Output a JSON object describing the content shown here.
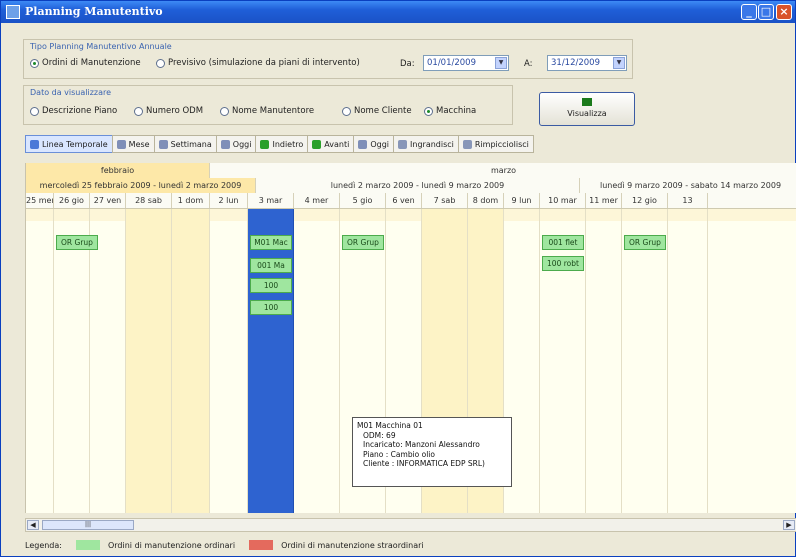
{
  "window": {
    "title": "Planning Manutentivo"
  },
  "mode_panel": {
    "title": "Tipo Planning Manutentivo Annuale",
    "options": [
      {
        "label": "Ordini di Manutenzione",
        "selected": true
      },
      {
        "label": "Previsivo (simulazione da piani di intervento)",
        "selected": false
      }
    ],
    "from_label": "Da:",
    "from_value": "01/01/2009",
    "to_label": "A:",
    "to_value": "31/12/2009"
  },
  "view_panel": {
    "title": "Dato da visualizzare",
    "options": [
      {
        "label": "Descrizione Piano",
        "selected": false
      },
      {
        "label": "Numero ODM",
        "selected": false
      },
      {
        "label": "Nome Manutentore",
        "selected": false
      },
      {
        "label": "Nome Cliente",
        "selected": false
      },
      {
        "label": "Macchina",
        "selected": true
      }
    ]
  },
  "visualize_button": {
    "label": "Visualizza",
    "icon": "monitor-icon"
  },
  "toolbar": [
    {
      "label": "Linea Temporale",
      "icon": "timeline-icon",
      "active": true
    },
    {
      "label": "Mese",
      "icon": "calendar-month-icon",
      "active": false
    },
    {
      "label": "Settimana",
      "icon": "calendar-week-icon",
      "active": false
    },
    {
      "label": "Oggi",
      "icon": "calendar-today-icon",
      "active": false
    },
    {
      "label": "Indietro",
      "icon": "back-arrow-icon",
      "active": false
    },
    {
      "label": "Avanti",
      "icon": "forward-arrow-icon",
      "active": false
    },
    {
      "label": "Oggi",
      "icon": "today-icon",
      "active": false
    },
    {
      "label": "Ingrandisci",
      "icon": "zoom-in-icon",
      "active": false
    },
    {
      "label": "Rimpicciolisci",
      "icon": "zoom-out-icon",
      "active": false
    }
  ],
  "calendar": {
    "months": [
      "febbraio",
      "marzo"
    ],
    "weeks": [
      "mercoledì 25 febbraio 2009 - lunedì 2 marzo 2009",
      "lunedì 2 marzo 2009 - lunedì 9 marzo 2009",
      "lunedì 9 marzo 2009 - sabato 14 marzo 2009"
    ],
    "days": [
      "25 mer",
      "26 gio",
      "27 ven",
      "28 sab",
      "1 dom",
      "2 lun",
      "3 mar",
      "4 mer",
      "5 gio",
      "6 ven",
      "7 sab",
      "8 dom",
      "9 lun",
      "10 mar",
      "11 mer",
      "12 gio",
      "13"
    ],
    "tasks": [
      {
        "label": "OR Grup"
      },
      {
        "label": "M01 Mac"
      },
      {
        "label": "001 Ma"
      },
      {
        "label": "100"
      },
      {
        "label": "100"
      },
      {
        "label": "OR Grup"
      },
      {
        "label": "001 flet"
      },
      {
        "label": "100 robt"
      },
      {
        "label": "OR Grup"
      }
    ],
    "tooltip": [
      "M01 Macchina 01",
      "ODM: 69",
      "Incaricato: Manzoni Alessandro",
      "Piano : Cambio olio",
      "Cliente : INFORMATICA EDP SRL)"
    ]
  },
  "legend": {
    "title": "Legenda:",
    "items": [
      {
        "label": "Ordini di manutenzione ordinari",
        "color": "#9fe69f"
      },
      {
        "label": "Ordini di manutenzione straordinari",
        "color": "#e46a5d"
      }
    ]
  },
  "colors": {
    "titlebar": "#1f5fd8",
    "today": "#2e63d0",
    "weekend": "#fdf3c6"
  }
}
